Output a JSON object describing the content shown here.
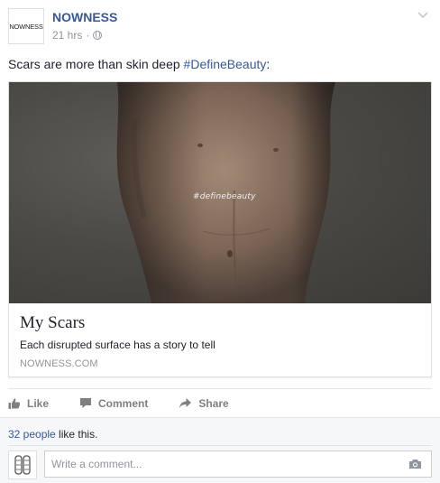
{
  "post": {
    "page_name": "NOWNESS",
    "avatar_text": "NOWNESS",
    "timestamp": "21 hrs",
    "separator": "·",
    "caption_text": "Scars are more than skin deep ",
    "caption_hashtag": "#DefineBeauty",
    "caption_suffix": ":"
  },
  "link_card": {
    "image_overlay_text": "#definebeauty",
    "title": "My Scars",
    "description": "Each disrupted surface has a story to tell",
    "domain": "NOWNESS.COM"
  },
  "actions": {
    "like_label": "Like",
    "comment_label": "Comment",
    "share_label": "Share"
  },
  "footer": {
    "likes_count_link": "32 people",
    "likes_suffix": " like this.",
    "comment_placeholder": "Write a comment..."
  },
  "colors": {
    "link_blue": "#365899",
    "meta_gray": "#90949c",
    "action_gray": "#7f7f7f",
    "footer_bg": "#f6f7f9"
  },
  "icons": [
    "globe-icon",
    "chevron-down-icon",
    "like-icon",
    "comment-icon",
    "share-icon",
    "camera-icon"
  ]
}
